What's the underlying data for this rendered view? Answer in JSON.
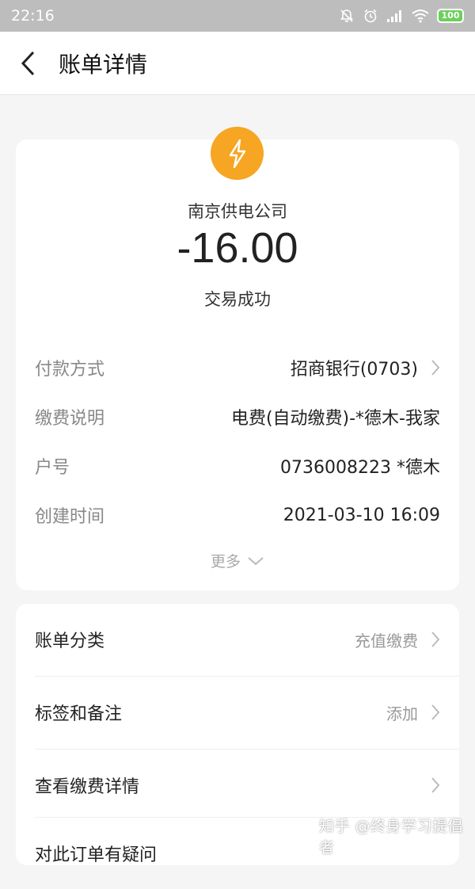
{
  "status_bar": {
    "time": "22:16",
    "battery": "100"
  },
  "header": {
    "title": "账单详情"
  },
  "bill": {
    "merchant": "南京供电公司",
    "amount": "-16.00",
    "status": "交易成功",
    "details": [
      {
        "label": "付款方式",
        "value": "招商银行(0703)"
      },
      {
        "label": "缴费说明",
        "value": "电费(自动缴费)-*德木-我家"
      },
      {
        "label": "户号",
        "value": "0736008223 *德木"
      },
      {
        "label": "创建时间",
        "value": "2021-03-10 16:09"
      }
    ],
    "more_label": "更多"
  },
  "actions": [
    {
      "label": "账单分类",
      "value": "充值缴费"
    },
    {
      "label": "标签和备注",
      "value": "添加"
    },
    {
      "label": "查看缴费详情",
      "value": ""
    },
    {
      "label": "对此订单有疑问",
      "value": ""
    }
  ],
  "watermark": "知乎 @终身学习提倡者",
  "colors": {
    "accent": "#f6a623",
    "status_bar_bg": "#bdbdbd"
  }
}
